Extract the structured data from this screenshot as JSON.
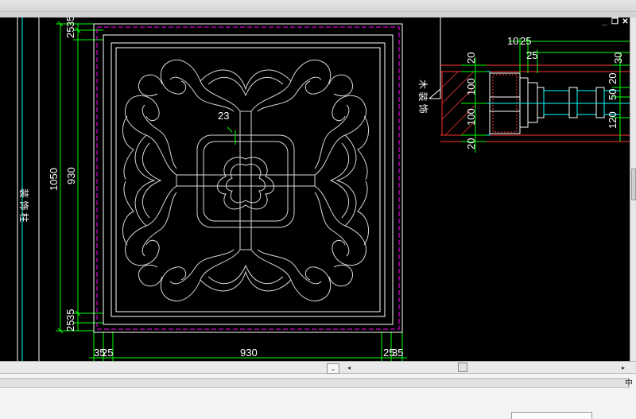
{
  "window": {
    "mdi_buttons": [
      {
        "name": "minimize",
        "glyph": "_"
      },
      {
        "name": "restore",
        "glyph": "❐"
      },
      {
        "name": "close",
        "glyph": "✕"
      }
    ]
  },
  "drawing": {
    "left_note": "装 饰 柱",
    "section_note": "木 装 饰",
    "label_23": "23",
    "dimensions": {
      "left_top_a": "25",
      "left_top_b": "35",
      "left_total": "1050",
      "left_inner": "930",
      "left_bottom_a": "35",
      "left_bottom_b": "25",
      "bottom_left_a": "35",
      "bottom_left_b": "25",
      "bottom_middle": "930",
      "bottom_right_a": "25",
      "bottom_right_b": "35"
    },
    "section_dimensions": {
      "top_10": "10",
      "top_25a": "25",
      "top_25b": "25",
      "right_30": "30",
      "v20_top": "20",
      "v100_top": "100",
      "v100_bottom": "100",
      "v20_bottom": "20",
      "right_20": "20",
      "right_50": "50",
      "right_120": "120"
    },
    "colors": {
      "canvas_bg": "#000000",
      "line_white": "#ffffff",
      "dim_green": "#00ff00",
      "line_cyan": "#00ffff",
      "line_magenta": "#ff00ff",
      "line_red": "#ff3333"
    }
  },
  "scrollbar": {
    "tab_dropdown_glyph": "⌄",
    "left_arrow": "◂",
    "right_arrow": "▸"
  },
  "bottom": {
    "side_glyph": "中"
  }
}
